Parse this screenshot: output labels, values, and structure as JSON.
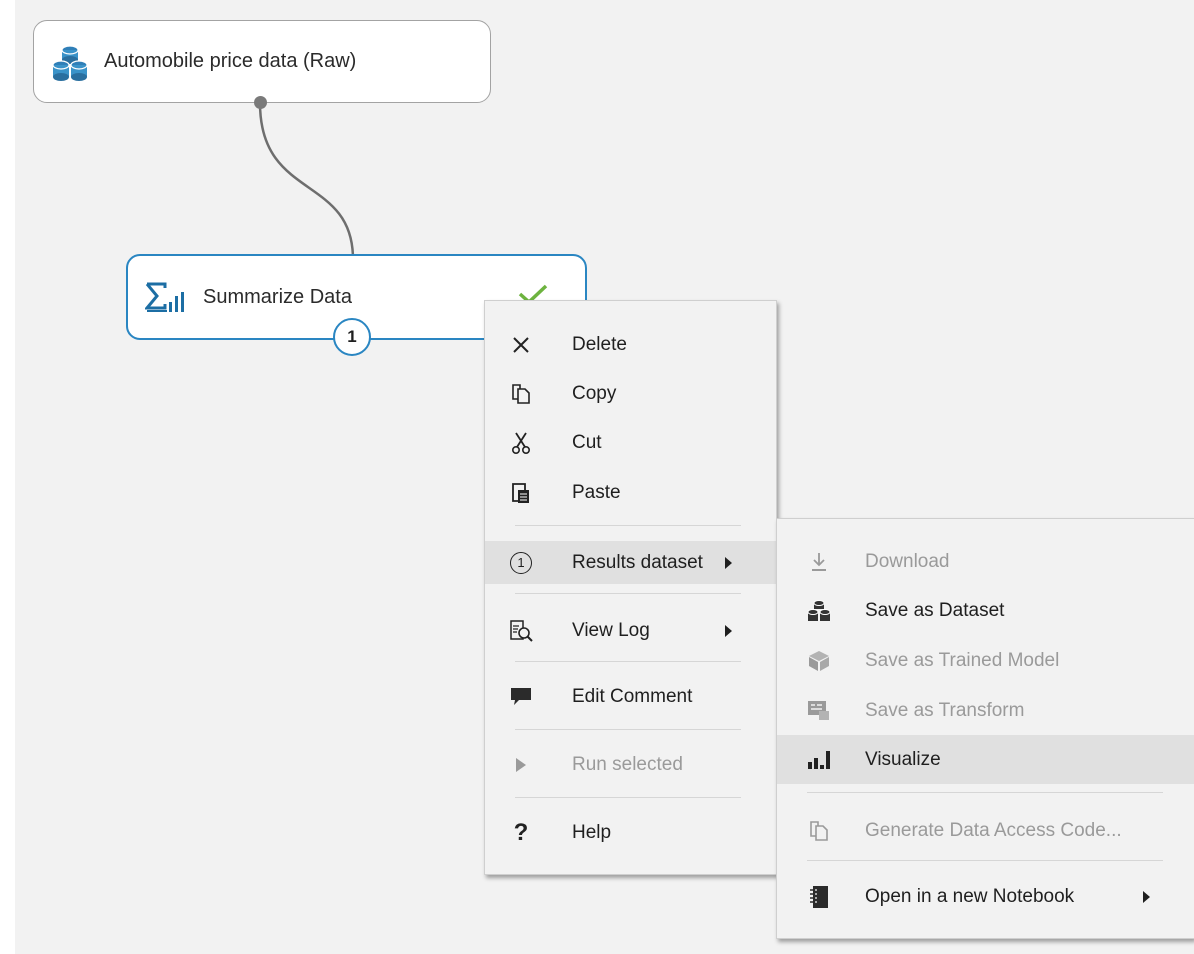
{
  "canvas": {
    "dataset_module": {
      "title": "Automobile price data (Raw)",
      "icon": "dataset-icon"
    },
    "summarize_module": {
      "title": "Summarize Data",
      "icon": "summarize-icon",
      "status": "completed",
      "output_port_number": "1"
    }
  },
  "context_menu": {
    "items": [
      {
        "label": "Delete",
        "icon": "delete-icon"
      },
      {
        "label": "Copy",
        "icon": "copy-icon"
      },
      {
        "label": "Cut",
        "icon": "cut-icon"
      },
      {
        "label": "Paste",
        "icon": "paste-icon"
      },
      {
        "label": "Results dataset",
        "icon": "port-one-icon",
        "has_submenu": true,
        "highlighted": true
      },
      {
        "label": "View Log",
        "icon": "view-log-icon",
        "has_submenu": true
      },
      {
        "label": "Edit Comment",
        "icon": "comment-icon"
      },
      {
        "label": "Run selected",
        "icon": "play-icon",
        "disabled": true
      },
      {
        "label": "Help",
        "icon": "help-icon"
      }
    ],
    "port_glyph": "1",
    "help_glyph": "?"
  },
  "submenu": {
    "items": [
      {
        "label": "Download",
        "icon": "download-icon",
        "disabled": true
      },
      {
        "label": "Save as Dataset",
        "icon": "dataset-icon"
      },
      {
        "label": "Save as Trained Model",
        "icon": "trained-model-icon",
        "disabled": true
      },
      {
        "label": "Save as Transform",
        "icon": "transform-icon",
        "disabled": true
      },
      {
        "label": "Visualize",
        "icon": "visualize-icon",
        "highlighted": true
      },
      {
        "label": "Generate Data Access Code...",
        "icon": "copy-icon",
        "disabled": true
      },
      {
        "label": "Open in a new Notebook",
        "icon": "notebook-icon",
        "has_submenu": true
      }
    ]
  },
  "colors": {
    "accent": "#2a86c2",
    "success": "#6db33f",
    "disabled": "#9a9a9a",
    "canvas_bg": "#f2f2f2"
  }
}
